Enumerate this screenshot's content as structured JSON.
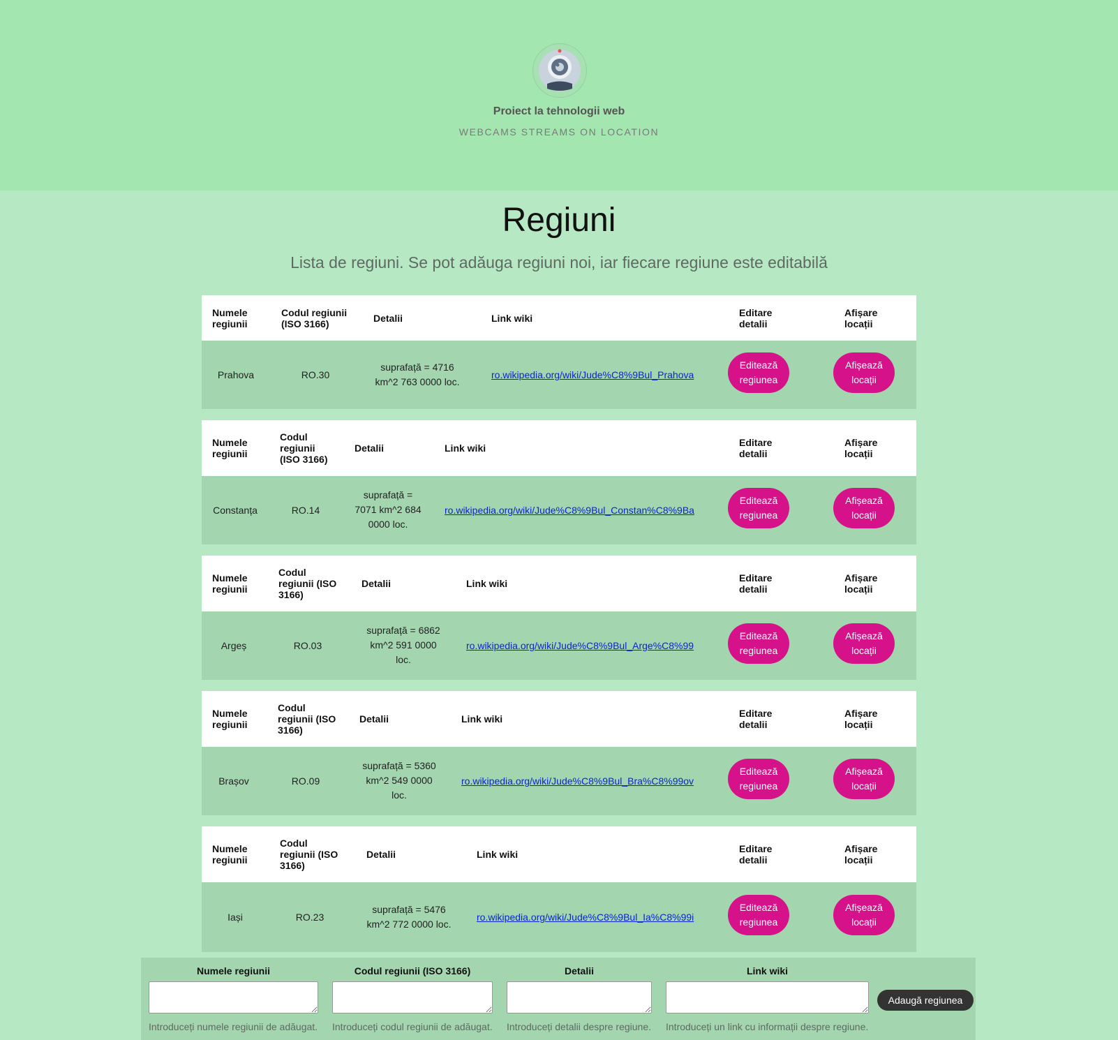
{
  "header": {
    "title": "Proiect la tehnologii web",
    "subtitle": "WEBCAMS STREAMS ON LOCATION",
    "logo_icon": "webcam-icon"
  },
  "page": {
    "heading": "Regiuni",
    "lead": "Lista de regiuni. Se pot adăuga regiuni noi, iar fiecare regiune este editabilă"
  },
  "columns": {
    "name": "Numele regiunii",
    "code": "Codul regiunii (ISO 3166)",
    "details": "Detalii",
    "wiki": "Link wiki",
    "edit": "Editare detalii",
    "show": "Afișare locații"
  },
  "regions": [
    {
      "name": "Prahova",
      "code": "RO.30",
      "details": "suprafață = 4716 km^2 763 0000 loc.",
      "wiki": "ro.wikipedia.org/wiki/Jude%C8%9Bul_Prahova",
      "edit_label": "Editează regiunea",
      "show_label": "Afișează locații"
    },
    {
      "name": "Constanța",
      "code": "RO.14",
      "details": "suprafață = 7071 km^2 684 0000 loc.",
      "wiki": "ro.wikipedia.org/wiki/Jude%C8%9Bul_Constan%C8%9Ba",
      "edit_label": "Editează regiunea",
      "show_label": "Afișează locații"
    },
    {
      "name": "Argeș",
      "code": "RO.03",
      "details": "suprafață = 6862 km^2 591 0000 loc.",
      "wiki": "ro.wikipedia.org/wiki/Jude%C8%9Bul_Arge%C8%99",
      "edit_label": "Editează regiunea",
      "show_label": "Afișează locații"
    },
    {
      "name": "Brașov",
      "code": "RO.09",
      "details": "suprafață = 5360 km^2 549 0000 loc.",
      "wiki": "ro.wikipedia.org/wiki/Jude%C8%9Bul_Bra%C8%99ov",
      "edit_label": "Editează regiunea",
      "show_label": "Afișează locații"
    },
    {
      "name": "Iași",
      "code": "RO.23",
      "details": "suprafață = 5476 km^2 772 0000 loc.",
      "wiki": "ro.wikipedia.org/wiki/Jude%C8%9Bul_Ia%C8%99i",
      "edit_label": "Editează regiunea",
      "show_label": "Afișează locații"
    }
  ],
  "form": {
    "name_label": "Numele regiunii",
    "code_label": "Codul regiunii (ISO 3166)",
    "details_label": "Detalii",
    "wiki_label": "Link wiki",
    "name_help": "Introduceți numele regiunii de adăugat.",
    "code_help": "Introduceți codul regiunii de adăugat.",
    "details_help": "Introduceți detalii despre regiune.",
    "wiki_help": "Introduceți un link cu informații despre regiune.",
    "submit_label": "Adaugă regiunea"
  }
}
